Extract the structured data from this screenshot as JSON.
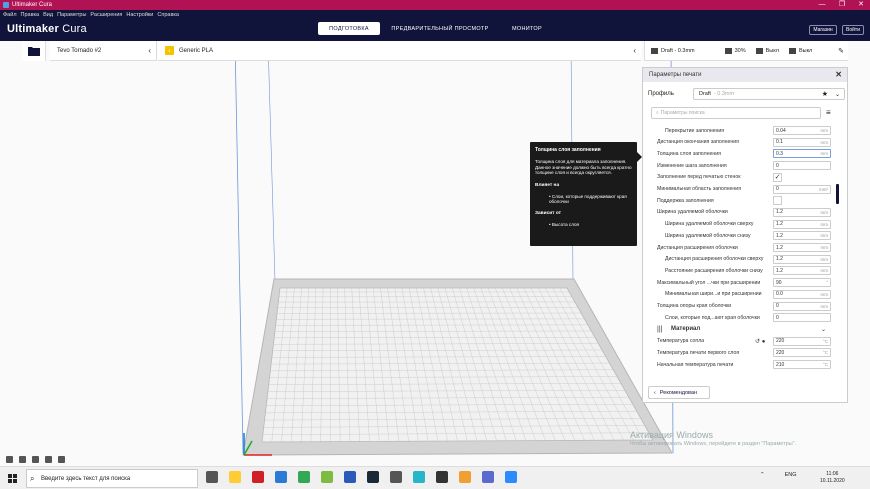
{
  "window": {
    "title": "Ultimaker Cura",
    "minimize": "—",
    "maximize": "❐",
    "close": "✕"
  },
  "menu": [
    "Файл",
    "Правка",
    "Вид",
    "Параметры",
    "Расширения",
    "Настройки",
    "Справка"
  ],
  "header": {
    "logo_bold": "Ultimaker",
    "logo_light": " Cura",
    "tabs": [
      "ПОДГОТОВКА",
      "ПРЕДВАРИТЕЛЬНЫЙ ПРОСМОТР",
      "МОНИТОР"
    ],
    "active_tab": 0,
    "shop_button": "Магазин",
    "login_button": "Войти"
  },
  "toolbar": {
    "printer": "Tevo Tornado #2",
    "material": "Generic PLA",
    "profile": "Draft - 0.3mm",
    "infill": "30%",
    "support": "Выкл",
    "adhesion": "Выкл"
  },
  "panel": {
    "title": "Параметры печати",
    "profile_label": "Профиль",
    "profile_value": "Draft",
    "profile_value_dim": "- 0.3mm",
    "search_placeholder": "Параметры поиска",
    "recommended_button": "Рекомендован",
    "settings": [
      {
        "label": "Перекрытие заполнения",
        "value": "0.04",
        "unit": "mm",
        "indent": 2
      },
      {
        "label": "Дистанция окончания заполнения",
        "value": "0.1",
        "unit": "mm",
        "indent": 0
      },
      {
        "label": "Толщина слоя заполнения",
        "value": "0.3",
        "unit": "mm",
        "indent": 0,
        "highlight": true
      },
      {
        "label": "Изменение шага заполнения",
        "value": "0",
        "unit": "",
        "indent": 0
      },
      {
        "label": "Заполнение перед печатью стенок",
        "value": "✓",
        "unit": "",
        "indent": 0,
        "checkbox": true
      },
      {
        "label": "Минимальная область заполнения",
        "value": "0",
        "unit": "mm²",
        "indent": 0
      },
      {
        "label": "Поддержка заполнения",
        "value": "",
        "unit": "",
        "indent": 0,
        "checkbox": true
      },
      {
        "label": "Ширина удаляемой оболочки",
        "value": "1.2",
        "unit": "mm",
        "indent": 0
      },
      {
        "label": "Ширина удаляемой оболочки сверху",
        "value": "1.2",
        "unit": "mm",
        "indent": 2
      },
      {
        "label": "Ширина удаляемой оболочки снизу",
        "value": "1.2",
        "unit": "mm",
        "indent": 2
      },
      {
        "label": "Дистанция расширения оболочки",
        "value": "1.2",
        "unit": "mm",
        "indent": 0
      },
      {
        "label": "Дистанция расширения оболочки сверху",
        "value": "1.2",
        "unit": "mm",
        "indent": 2
      },
      {
        "label": "Расстояние расширения оболочки снизу",
        "value": "1.2",
        "unit": "mm",
        "indent": 2
      },
      {
        "label": "Максимальный угол ...чки при расширении",
        "value": "90",
        "unit": "°",
        "indent": 0
      },
      {
        "label": "Минимальная шири...и при расширении",
        "value": "0.0",
        "unit": "mm",
        "indent": 2
      },
      {
        "label": "Толщина опоры края оболочки",
        "value": "0",
        "unit": "mm",
        "indent": 0
      },
      {
        "label": "Слои, которые под...ают края оболочки",
        "value": "0",
        "unit": "",
        "indent": 2
      },
      {
        "label": "Материал",
        "value": "",
        "unit": "",
        "category": true
      },
      {
        "label": "Температура сопла",
        "value": "220",
        "unit": "°C",
        "indent": 0
      },
      {
        "label": "Температура печати первого слоя",
        "value": "220",
        "unit": "°C",
        "indent": 0
      },
      {
        "label": "Начальная температура печати",
        "value": "210",
        "unit": "°C",
        "indent": 0
      }
    ]
  },
  "tooltip": {
    "title": "Толщина слоя заполнения",
    "body": "Толщина слоя для материала заполнения. Данное значение должно быть всегда кратно толщине слоя и всегда округляется.",
    "affects_heading": "Влияет на",
    "affects_item": "• Слои, которые поддерживают края оболочки",
    "depends_heading": "Зависит от",
    "depends_item": "• Высота слоя"
  },
  "watermark": {
    "line1": "Активация Windows",
    "line2": "Чтобы активировать Windows, перейдите в раздел \"Параметры\"."
  },
  "taskbar": {
    "search_placeholder": "Введите здесь текст для поиска",
    "lang": "ENG",
    "time": "11:06",
    "date": "10.11.2020",
    "app_colors": [
      "#555",
      "#ffcc33",
      "#d02027",
      "#2b7bd6",
      "#33a853",
      "#7dbb42",
      "#2a5ab8",
      "#1b2838",
      "#555",
      "#26b5c9",
      "#333",
      "#f0a030",
      "#5a6acf",
      "#2b8cff"
    ]
  }
}
